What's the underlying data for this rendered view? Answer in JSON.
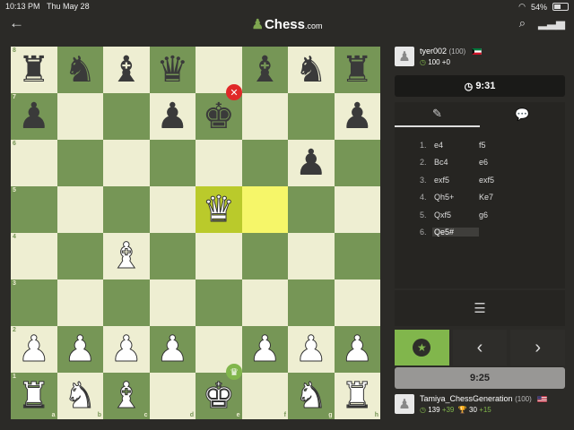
{
  "status_bar": {
    "time": "10:13 PM",
    "date": "Thu May 28",
    "battery": "54%"
  },
  "app": {
    "logo_main": "Chess",
    "logo_suffix": ".com"
  },
  "board": {
    "files": [
      "a",
      "b",
      "c",
      "d",
      "e",
      "f",
      "g",
      "h"
    ],
    "ranks": [
      "8",
      "7",
      "6",
      "5",
      "4",
      "3",
      "2",
      "1"
    ],
    "rows": [
      [
        "bR",
        "bN",
        "bB",
        "bQ",
        "",
        "bB",
        "bN",
        "bR"
      ],
      [
        "bP",
        "",
        "",
        "bP",
        "bK",
        "",
        "",
        "bP"
      ],
      [
        "",
        "",
        "",
        "",
        "",
        "",
        "bP",
        ""
      ],
      [
        "",
        "",
        "",
        "",
        "wQ",
        "",
        "",
        ""
      ],
      [
        "",
        "",
        "wB",
        "",
        "",
        "",
        "",
        ""
      ],
      [
        "",
        "",
        "",
        "",
        "",
        "",
        "",
        ""
      ],
      [
        "wP",
        "wP",
        "wP",
        "wP",
        "",
        "wP",
        "wP",
        "wP"
      ],
      [
        "wR",
        "wN",
        "wB",
        "",
        "wK",
        "",
        "wN",
        "wR"
      ]
    ],
    "highlight": [
      "e5",
      "f5"
    ],
    "checkmate_on": "e7",
    "winner_on": "e1"
  },
  "opponent": {
    "name": "tyer002",
    "rating": "(100)",
    "stats": "100 +0",
    "clock": "9:31"
  },
  "player": {
    "name": "Tamiya_ChessGeneration",
    "rating": "(100)",
    "puzzle_rating": "139",
    "puzzle_delta": "+39",
    "trophy_rating": "30",
    "trophy_delta": "+15",
    "clock": "9:25"
  },
  "moves": [
    {
      "num": "1.",
      "white": "e4",
      "black": "f5"
    },
    {
      "num": "2.",
      "white": "Bc4",
      "black": "e6"
    },
    {
      "num": "3.",
      "white": "exf5",
      "black": "exf5"
    },
    {
      "num": "4.",
      "white": "Qh5+",
      "black": "Ke7"
    },
    {
      "num": "5.",
      "white": "Qxf5",
      "black": "g6"
    },
    {
      "num": "6.",
      "white": "Qe5#",
      "black": ""
    }
  ],
  "icons": {
    "back": "←",
    "search": "⌕",
    "signal": "▮",
    "clock": "◷",
    "list": "☰",
    "prev": "‹",
    "next": "›",
    "star": "★",
    "mate": "✕",
    "win": "♛",
    "chat": "💬",
    "moves_tab": "✎"
  },
  "colors": {
    "light_square": "#eeeed2",
    "dark_square": "#769656",
    "accent": "#81b64c",
    "mate": "#e02828"
  }
}
